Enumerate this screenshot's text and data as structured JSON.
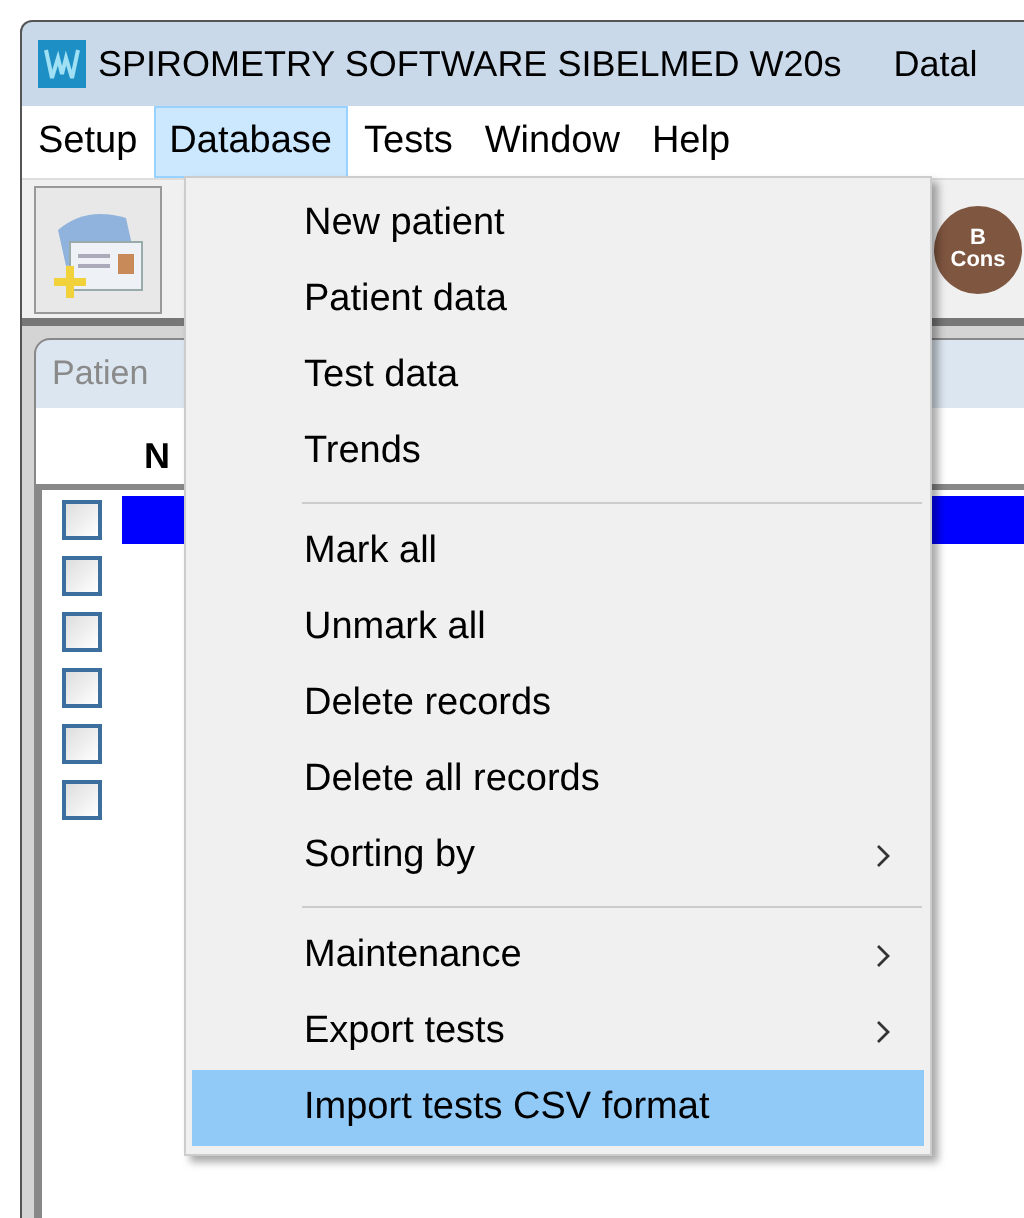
{
  "window": {
    "title": "SPIROMETRY SOFTWARE SIBELMED W20s",
    "title_extra": "Datal"
  },
  "menu_bar": [
    {
      "label": "Setup",
      "selected": false
    },
    {
      "label": "Database",
      "selected": true
    },
    {
      "label": "Tests",
      "selected": false
    },
    {
      "label": "Window",
      "selected": false
    },
    {
      "label": "Help",
      "selected": false
    }
  ],
  "toolbar": {
    "badge_top": "B",
    "badge_bottom": "Cons"
  },
  "child_window": {
    "title": "Patien",
    "column_header": "N",
    "rows": [
      {
        "checked": false,
        "selected": true
      },
      {
        "checked": false,
        "selected": false
      },
      {
        "checked": false,
        "selected": false
      },
      {
        "checked": false,
        "selected": false
      },
      {
        "checked": false,
        "selected": false
      },
      {
        "checked": false,
        "selected": false
      }
    ]
  },
  "dropdown": [
    {
      "kind": "item",
      "label": "New patient",
      "submenu": false,
      "selected": false
    },
    {
      "kind": "item",
      "label": "Patient data",
      "submenu": false,
      "selected": false
    },
    {
      "kind": "item",
      "label": "Test data",
      "submenu": false,
      "selected": false
    },
    {
      "kind": "item",
      "label": "Trends",
      "submenu": false,
      "selected": false
    },
    {
      "kind": "separator"
    },
    {
      "kind": "item",
      "label": "Mark all",
      "submenu": false,
      "selected": false
    },
    {
      "kind": "item",
      "label": "Unmark all",
      "submenu": false,
      "selected": false
    },
    {
      "kind": "item",
      "label": "Delete records",
      "submenu": false,
      "selected": false
    },
    {
      "kind": "item",
      "label": "Delete all records",
      "submenu": false,
      "selected": false
    },
    {
      "kind": "item",
      "label": "Sorting by",
      "submenu": true,
      "selected": false
    },
    {
      "kind": "separator"
    },
    {
      "kind": "item",
      "label": "Maintenance",
      "submenu": true,
      "selected": false
    },
    {
      "kind": "item",
      "label": "Export tests",
      "submenu": true,
      "selected": false
    },
    {
      "kind": "item",
      "label": "Import tests CSV format",
      "submenu": false,
      "selected": true
    }
  ]
}
